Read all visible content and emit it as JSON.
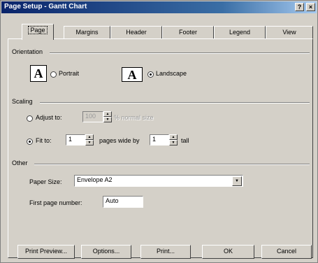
{
  "window": {
    "title": "Page Setup - Gantt Chart",
    "help_glyph": "?",
    "close_glyph": "×"
  },
  "tabs": [
    {
      "label": "Page"
    },
    {
      "label": "Margins"
    },
    {
      "label": "Header"
    },
    {
      "label": "Footer"
    },
    {
      "label": "Legend"
    },
    {
      "label": "View"
    }
  ],
  "orientation": {
    "group_label": "Orientation",
    "portrait_label": "Portrait",
    "landscape_label": "Landscape",
    "icon_glyph": "A",
    "selected": "landscape"
  },
  "scaling": {
    "group_label": "Scaling",
    "adjust_label": "Adjust to:",
    "adjust_value": "100",
    "adjust_suffix": "% normal size",
    "fit_label": "Fit to:",
    "fit_wide_value": "1",
    "fit_wide_suffix": "pages wide by",
    "fit_tall_value": "1",
    "fit_tall_suffix": "tall",
    "selected": "fit"
  },
  "other": {
    "group_label": "Other",
    "paper_size_label": "Paper Size:",
    "paper_size_value": "Envelope A2",
    "first_page_label": "First page number:",
    "first_page_value": "Auto"
  },
  "buttons": {
    "print_preview": "Print Preview...",
    "options": "Options...",
    "print": "Print...",
    "ok": "OK",
    "cancel": "Cancel"
  }
}
